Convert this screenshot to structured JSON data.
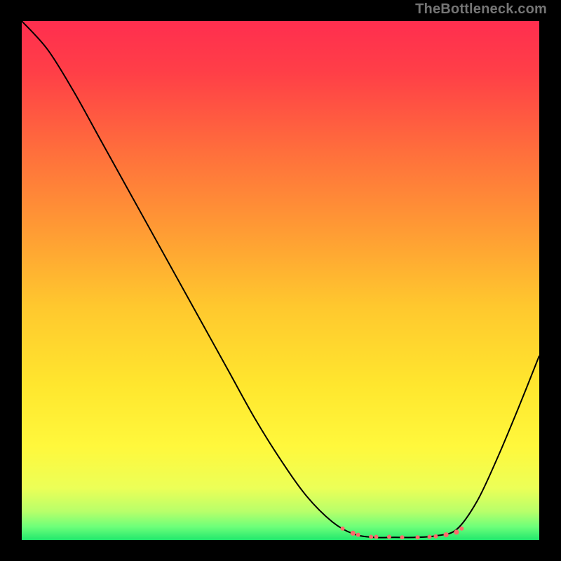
{
  "attribution": "TheBottleneck.com",
  "chart_data": {
    "type": "line",
    "title": "",
    "xlabel": "",
    "ylabel": "",
    "xlim": [
      0,
      1
    ],
    "ylim": [
      0,
      1
    ],
    "curve": {
      "x": [
        0.0,
        0.05,
        0.1,
        0.15,
        0.2,
        0.25,
        0.3,
        0.35,
        0.4,
        0.45,
        0.5,
        0.55,
        0.6,
        0.64,
        0.68,
        0.72,
        0.76,
        0.8,
        0.84,
        0.88,
        0.92,
        0.96,
        1.0
      ],
      "y": [
        1.0,
        0.945,
        0.865,
        0.775,
        0.685,
        0.595,
        0.505,
        0.415,
        0.325,
        0.235,
        0.155,
        0.085,
        0.035,
        0.012,
        0.005,
        0.005,
        0.005,
        0.008,
        0.02,
        0.075,
        0.16,
        0.255,
        0.355
      ]
    },
    "accent_points": {
      "x": [
        0.62,
        0.64,
        0.65,
        0.675,
        0.685,
        0.71,
        0.735,
        0.765,
        0.788,
        0.8,
        0.82,
        0.84,
        0.85
      ],
      "y": [
        0.022,
        0.013,
        0.01,
        0.006,
        0.006,
        0.006,
        0.005,
        0.005,
        0.006,
        0.007,
        0.01,
        0.015,
        0.022
      ],
      "r": [
        3.0,
        3.6,
        3.0,
        3.0,
        3.0,
        3.0,
        3.0,
        3.0,
        3.0,
        3.0,
        3.6,
        3.6,
        3.0
      ]
    },
    "gradient_stops": [
      {
        "offset": 0.0,
        "color": "#ff2e4f"
      },
      {
        "offset": 0.1,
        "color": "#ff3f47"
      },
      {
        "offset": 0.25,
        "color": "#ff6e3c"
      },
      {
        "offset": 0.4,
        "color": "#ff9a34"
      },
      {
        "offset": 0.55,
        "color": "#ffc82e"
      },
      {
        "offset": 0.7,
        "color": "#ffe62e"
      },
      {
        "offset": 0.82,
        "color": "#fff83c"
      },
      {
        "offset": 0.9,
        "color": "#ecff57"
      },
      {
        "offset": 0.945,
        "color": "#b8ff6a"
      },
      {
        "offset": 0.975,
        "color": "#6cff7a"
      },
      {
        "offset": 1.0,
        "color": "#22e86d"
      }
    ],
    "colors": {
      "curve_stroke": "#000000",
      "accent_fill": "#ff6b6b",
      "frame_bg": "#000000"
    }
  }
}
